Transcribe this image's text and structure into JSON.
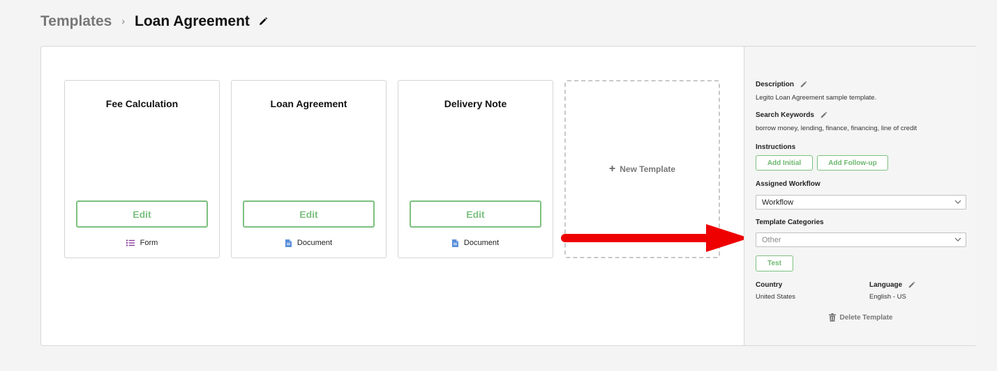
{
  "breadcrumb": {
    "root": "Templates",
    "separator": "›",
    "current": "Loan Agreement"
  },
  "cards": [
    {
      "title": "Fee Calculation",
      "edit_label": "Edit",
      "type_label": "Form",
      "type_icon": "list-icon"
    },
    {
      "title": "Loan Agreement",
      "edit_label": "Edit",
      "type_label": "Document",
      "type_icon": "document-icon"
    },
    {
      "title": "Delivery Note",
      "edit_label": "Edit",
      "type_label": "Document",
      "type_icon": "document-icon"
    }
  ],
  "new_template": {
    "plus": "+",
    "label": "New Template"
  },
  "sidebar": {
    "description": {
      "label": "Description",
      "value": "Legito Loan Agreement sample template."
    },
    "keywords": {
      "label": "Search Keywords",
      "value": "borrow money, lending, finance, financing, line of credit"
    },
    "instructions": {
      "label": "Instructions",
      "add_initial": "Add Initial",
      "add_followup": "Add Follow-up"
    },
    "workflow": {
      "label": "Assigned Workflow",
      "value": "Workflow"
    },
    "categories": {
      "label": "Template Categories",
      "value": "Other"
    },
    "test_label": "Test",
    "country": {
      "label": "Country",
      "value": "United States"
    },
    "language": {
      "label": "Language",
      "value": "English - US"
    },
    "delete_label": "Delete Template"
  },
  "colors": {
    "accent_green": "#7cc07f",
    "arrow_red": "#ee0000",
    "form_icon": "#8a3d9a",
    "doc_icon": "#5b8fd9"
  }
}
